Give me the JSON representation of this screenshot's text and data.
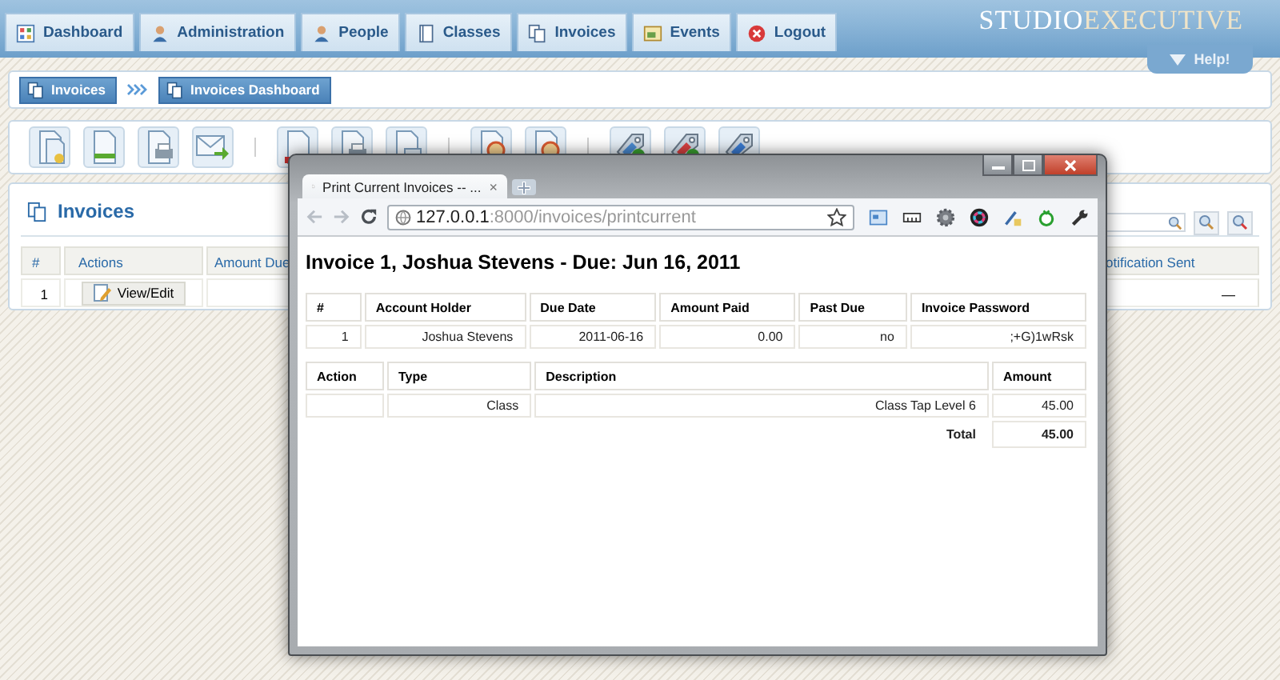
{
  "nav": {
    "tabs": [
      {
        "label": "Dashboard",
        "kind": "grid"
      },
      {
        "label": "Administration",
        "kind": "person"
      },
      {
        "label": "People",
        "kind": "person"
      },
      {
        "label": "Classes",
        "kind": "book"
      },
      {
        "label": "Invoices",
        "kind": "docs"
      },
      {
        "label": "Events",
        "kind": "calendar"
      },
      {
        "label": "Logout",
        "kind": "logout"
      }
    ]
  },
  "logo": {
    "first": "STUDIO",
    "second": "EXECUTIVE"
  },
  "help": "Help!",
  "breadcrumb": [
    "Invoices",
    "Invoices Dashboard"
  ],
  "invoices_panel": {
    "title": "Invoices",
    "columns": [
      "#",
      "Actions",
      "Amount Due",
      "otification Sent"
    ],
    "rows": [
      {
        "number": "1",
        "action": "View/Edit",
        "last": "—"
      }
    ]
  },
  "browser": {
    "tab_title": "Print Current Invoices -- ...",
    "tab_close": "×",
    "url_host": "127.0.0.1",
    "url_path": ":8000/invoices/printcurrent",
    "heading": "Invoice 1, Joshua Stevens - Due: Jun 16, 2011",
    "summary": {
      "columns": [
        "#",
        "Account Holder",
        "Due Date",
        "Amount Paid",
        "Past Due",
        "Invoice Password"
      ],
      "rows": [
        [
          "1",
          "Joshua Stevens",
          "2011-06-16",
          "0.00",
          "no",
          ";+G)1wRsk"
        ]
      ]
    },
    "items": {
      "columns": [
        "Action",
        "Type",
        "Description",
        "Amount"
      ],
      "rows": [
        [
          "",
          "Class",
          "Class Tap Level 6",
          "45.00"
        ]
      ],
      "total_label": "Total",
      "total": "45.00"
    }
  }
}
